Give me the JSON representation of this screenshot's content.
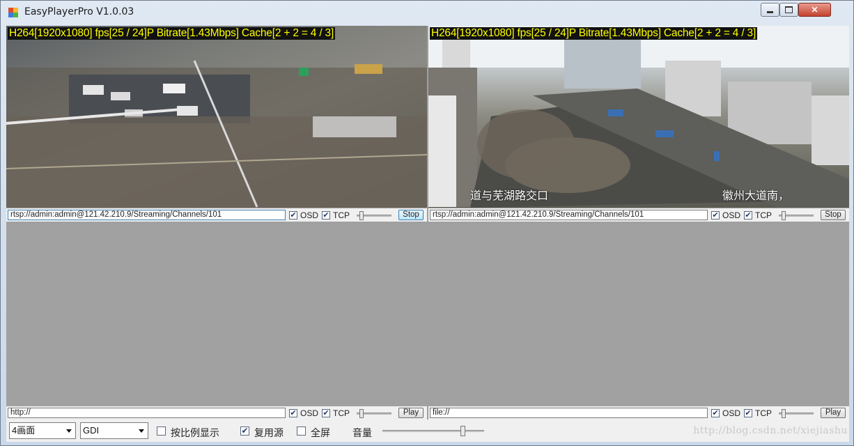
{
  "window": {
    "title": "EasyPlayerPro V1.0.03"
  },
  "panes": [
    {
      "osd": "H264[1920x1080] fps[25 / 24]P Bitrate[1.43Mbps] Cache[2 + 2 = 4 / 3]",
      "url": "rtsp://admin:admin@121.42.210.9/Streaming/Channels/101",
      "osd_label": "OSD",
      "tcp_label": "TCP",
      "button": "Stop"
    },
    {
      "osd": "H264[1920x1080] fps[25 / 24]P Bitrate[1.43Mbps] Cache[2 + 2 = 4 / 3]",
      "url": "rtsp://admin:admin@121.42.210.9/Streaming/Channels/101",
      "osd_label": "OSD",
      "tcp_label": "TCP",
      "button": "Stop",
      "caption_left": "道与芜湖路交口",
      "caption_right": "徽州大道南，"
    },
    {
      "url": "http://",
      "osd_label": "OSD",
      "tcp_label": "TCP",
      "button": "Play"
    },
    {
      "url": "file://",
      "osd_label": "OSD",
      "tcp_label": "TCP",
      "button": "Play"
    }
  ],
  "bottom": {
    "layout_select": "4画面",
    "render_select": "GDI",
    "keep_ratio_label": "按比例显示",
    "reuse_source_label": "复用源",
    "fullscreen_label": "全屏",
    "volume_label": "音量",
    "watermark": "http://blog.csdn.net/xiejiashu"
  },
  "colors": {
    "osd_text": "#ffff00",
    "pane_bg": "#a1a1a1"
  }
}
